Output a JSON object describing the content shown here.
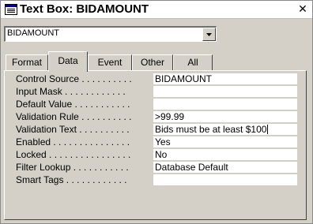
{
  "window": {
    "title": "Text Box: BIDAMOUNT"
  },
  "object_selector": {
    "value": "BIDAMOUNT"
  },
  "tabs": [
    {
      "label": "Format",
      "active": false
    },
    {
      "label": "Data",
      "active": true
    },
    {
      "label": "Event",
      "active": false
    },
    {
      "label": "Other",
      "active": false
    },
    {
      "label": "All",
      "active": false
    }
  ],
  "properties": [
    {
      "label": "Control Source . . . . . . . . . .",
      "value": "BIDAMOUNT"
    },
    {
      "label": "Input Mask . . . . . . . . . . . .",
      "value": ""
    },
    {
      "label": "Default Value . . . . . . . . . . .",
      "value": ""
    },
    {
      "label": "Validation Rule . . . . . . . . . .",
      "value": ">99.99"
    },
    {
      "label": "Validation Text . . . . . . . . . .",
      "value": "Bids must be at least $100"
    },
    {
      "label": "Enabled . . . . . . . . . . . . . . .",
      "value": "Yes"
    },
    {
      "label": "Locked . . . . . . . . . . . . . . . .",
      "value": "No"
    },
    {
      "label": "Filter Lookup . . . . . . . . . . .",
      "value": "Database Default"
    },
    {
      "label": "Smart Tags . . . . . . . . . . . .",
      "value": ""
    }
  ]
}
